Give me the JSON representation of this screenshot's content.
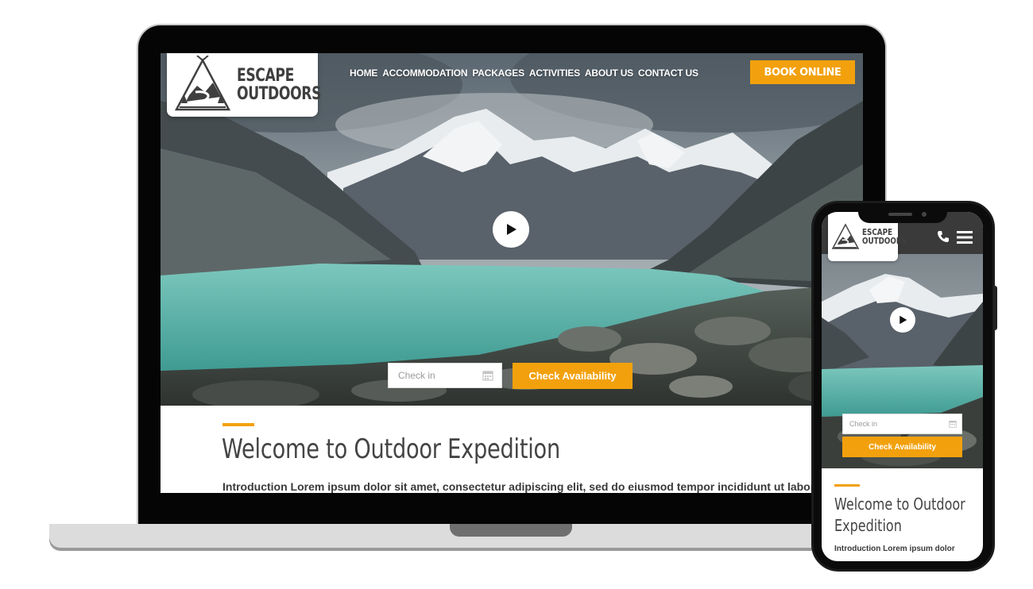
{
  "brand": {
    "name_line1": "ESCAPE",
    "name_line2": "OUTDOORS",
    "emblem_text": "ESCAPE OUTDOORS"
  },
  "nav": {
    "items": [
      "HOME",
      "ACCOMMODATION",
      "PACKAGES",
      "ACTIVITIES",
      "ABOUT US",
      "CONTACT US"
    ]
  },
  "header": {
    "book_label": "BOOK ONLINE"
  },
  "booking": {
    "checkin_placeholder": "Check in",
    "check_button": "Check Availability"
  },
  "content": {
    "title": "Welcome to Outdoor Expedition",
    "intro": "Introduction Lorem ipsum dolor sit amet, consectetur adipiscing elit, sed do eiusmod tempor incididunt ut labore"
  },
  "mobile": {
    "title": "Welcome to Outdoor Expedition",
    "intro": "Introduction Lorem ipsum dolor"
  },
  "icons": [
    "play-icon",
    "calendar-icon",
    "phone-icon",
    "hamburger-menu-icon",
    "tent-logo-icon"
  ],
  "colors": {
    "accent": "#f2a10d",
    "heading": "#444444",
    "lake": "#5fb7ad",
    "header_dark": "#3a3a3a"
  }
}
